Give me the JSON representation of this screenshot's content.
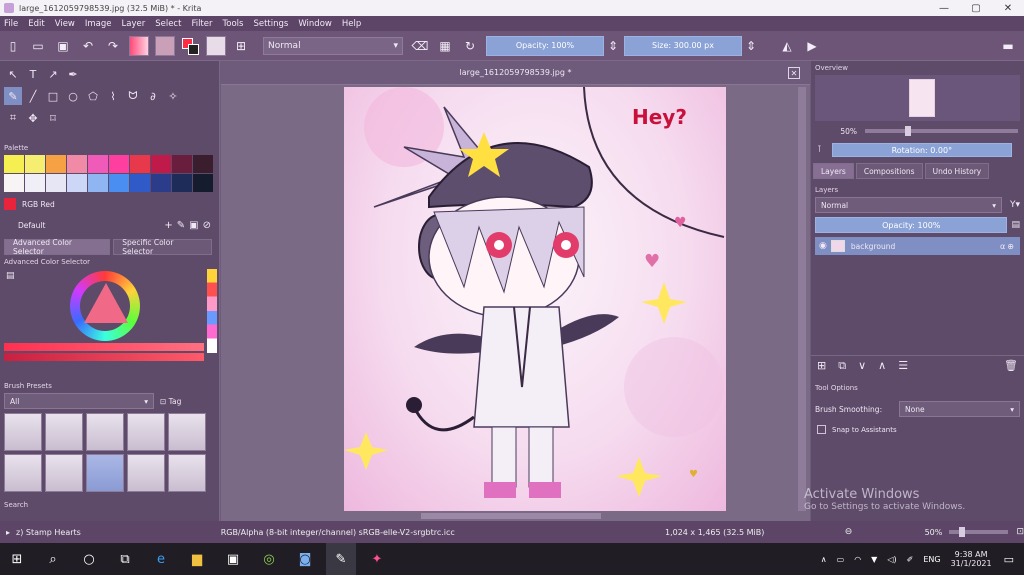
{
  "titlebar": {
    "title": "large_1612059798539.jpg (32.5 MiB) * - Krita",
    "minimize": "—",
    "maximize": "▢",
    "close": "✕"
  },
  "menu": [
    "File",
    "Edit",
    "View",
    "Image",
    "Layer",
    "Select",
    "Filter",
    "Tools",
    "Settings",
    "Window",
    "Help"
  ],
  "toolbar": {
    "blend_mode": "Normal",
    "opacity_label": "Opacity: 100%",
    "size_label": "Size: 300.00 px"
  },
  "left": {
    "palette_title": "Palette",
    "palette_colors": [
      "#f6ef52",
      "#f6ee70",
      "#f6a244",
      "#f08aa6",
      "#f05ab8",
      "#ff3f9f",
      "#e8384c",
      "#c01a4a",
      "#6a1e3e",
      "#3a1e2e",
      "#f8f4f6",
      "#f0eef6",
      "#e6e6f4",
      "#ccd6f6",
      "#8fb6f2",
      "#4a8ef2",
      "#305ac8",
      "#2a3c8a",
      "#1e2c5a",
      "#141c2e"
    ],
    "selected_color": "#e8243c",
    "color_name": "RGB Red",
    "palette_name": "Default",
    "tab_advanced": "Advanced Color Selector",
    "tab_specific": "Specific Color Selector",
    "color_selector_title": "Advanced Color Selector",
    "brush_presets_title": "Brush Presets",
    "brush_filter": "All",
    "brush_tag": "Tag",
    "search_label": "Search"
  },
  "canvas": {
    "doc_tab": "large_1612059798539.jpg *",
    "speech_text": "Hey?"
  },
  "right": {
    "overview_title": "Overview",
    "zoom_value": "50%",
    "rotation_label": "Rotation: 0.00°",
    "tabs": [
      "Layers",
      "Compositions",
      "Undo History"
    ],
    "layers_title": "Layers",
    "layer_blend": "Normal",
    "layer_opacity": "Opacity: 100%",
    "layer_name": "background",
    "tool_options_title": "Tool Options",
    "brush_smoothing_label": "Brush Smoothing:",
    "brush_smoothing_value": "None",
    "snap_label": "Snap to Assistants"
  },
  "status": {
    "brush_name": "z) Stamp Hearts",
    "color_space": "RGB/Alpha (8-bit integer/channel)  sRGB-elle-V2-srgbtrc.icc",
    "dimensions": "1,024 x 1,465 (32.5 MiB)",
    "zoom": "50%"
  },
  "watermark": {
    "line1": "Activate Windows",
    "line2": "Go to Settings to activate Windows."
  },
  "taskbar": {
    "language": "ENG",
    "time": "9:38 AM",
    "date": "31/1/2021"
  },
  "colors": {
    "accent": "#8aa2d6",
    "panel": "#5e4a69"
  }
}
